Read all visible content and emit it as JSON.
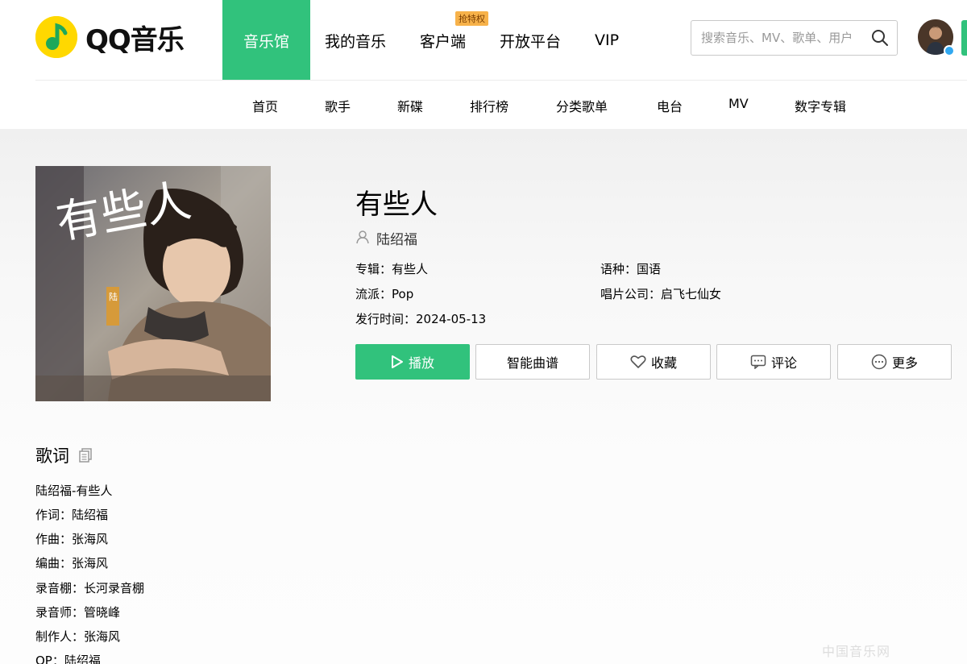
{
  "brand": {
    "name": "QQ音乐"
  },
  "main_nav": [
    {
      "label": "音乐馆",
      "active": true
    },
    {
      "label": "我的音乐",
      "active": false
    },
    {
      "label": "客户端",
      "active": false,
      "badge": "抢特权"
    },
    {
      "label": "开放平台",
      "active": false
    },
    {
      "label": "VIP",
      "active": false
    }
  ],
  "search": {
    "placeholder": "搜索音乐、MV、歌单、用户"
  },
  "sub_nav": [
    "首页",
    "歌手",
    "新碟",
    "排行榜",
    "分类歌单",
    "电台",
    "MV",
    "数字专辑"
  ],
  "song": {
    "title": "有些人",
    "singer": "陆绍福",
    "album": "专辑：有些人",
    "genre": "流派：Pop",
    "release": "发行时间：2024-05-13",
    "language": "语种：国语",
    "company": "唱片公司：启飞七仙女"
  },
  "cover": {
    "title_art": "有些人",
    "artist_tag": "陆绍福"
  },
  "buttons": {
    "play": "播放",
    "score": "智能曲谱",
    "favorite": "收藏",
    "comment": "评论",
    "more": "更多"
  },
  "lyrics": {
    "title": "歌词",
    "lines": [
      "陆绍福-有些人",
      "作词：陆绍福",
      "作曲：张海风",
      "编曲：张海风",
      "录音棚：长河录音棚",
      "录音师：管晓峰",
      "制作人：张海风",
      "OP：陆绍福"
    ]
  },
  "watermark": "中国音乐网",
  "colors": {
    "accent": "#31c27c",
    "logo_yellow": "#ffd800",
    "badge": "#f7b24a"
  }
}
